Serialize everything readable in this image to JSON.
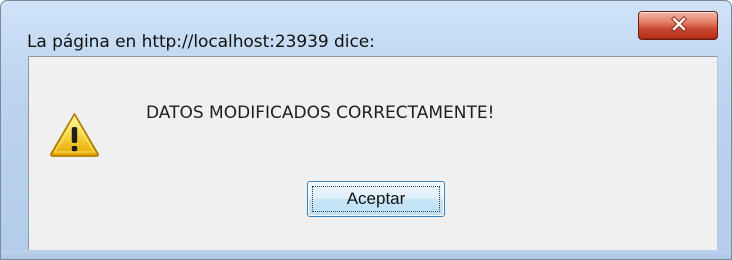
{
  "dialog": {
    "title": "La página en http://localhost:23939 dice:",
    "message": "DATOS MODIFICADOS CORRECTAMENTE!",
    "ok_label": "Aceptar",
    "icons": {
      "close": "close-icon",
      "warning": "warning-icon"
    }
  },
  "colors": {
    "titlebar": "#bcd4ef",
    "client_background": "#f0f0f0",
    "close_button": "#c9472e",
    "button_border": "#3c7fb1",
    "warning_fill": "#f5c400"
  }
}
